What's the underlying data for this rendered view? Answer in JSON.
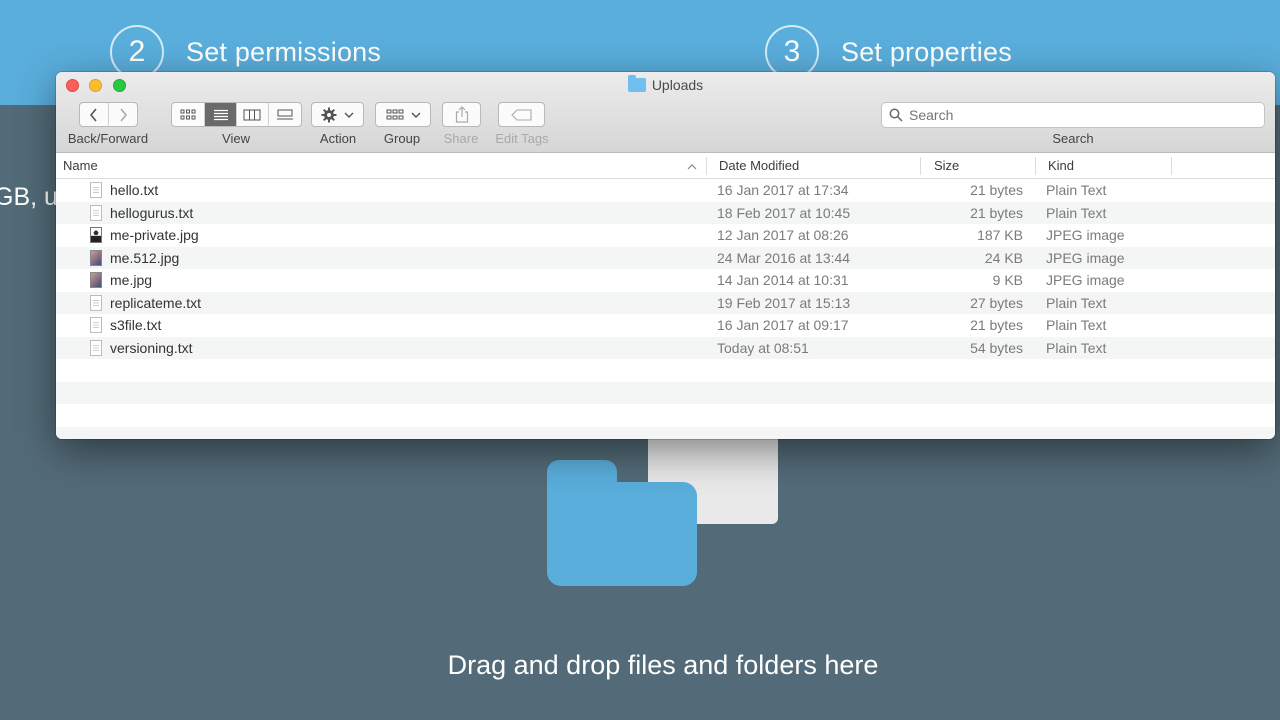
{
  "background": {
    "steps": [
      {
        "number": "2",
        "title": "Set permissions"
      },
      {
        "number": "3",
        "title": "Set properties"
      }
    ],
    "left_partial_text": "GB, u",
    "dropzone_text": "Drag and drop files and folders here"
  },
  "finder": {
    "title": "Uploads",
    "toolbar": {
      "back_forward_label": "Back/Forward",
      "view_label": "View",
      "action_label": "Action",
      "group_label": "Group",
      "share_label": "Share",
      "edit_tags_label": "Edit Tags",
      "search_label": "Search",
      "search_placeholder": "Search",
      "selected_view": "list"
    },
    "columns": {
      "name": "Name",
      "date": "Date Modified",
      "size": "Size",
      "kind": "Kind"
    },
    "files": [
      {
        "name": "hello.txt",
        "date": "16 Jan 2017 at 17:34",
        "size": "21 bytes",
        "kind": "Plain Text",
        "icon": "text-file-icon"
      },
      {
        "name": "hellogurus.txt",
        "date": "18 Feb 2017 at 10:45",
        "size": "21 bytes",
        "kind": "Plain Text",
        "icon": "text-file-icon"
      },
      {
        "name": "me-private.jpg",
        "date": "12 Jan 2017 at 08:26",
        "size": "187 KB",
        "kind": "JPEG image",
        "icon": "portrait-image-icon"
      },
      {
        "name": "me.512.jpg",
        "date": "24 Mar 2016 at 13:44",
        "size": "24 KB",
        "kind": "JPEG image",
        "icon": "image-file-icon"
      },
      {
        "name": "me.jpg",
        "date": "14 Jan 2014 at 10:31",
        "size": "9 KB",
        "kind": "JPEG image",
        "icon": "image-file-icon"
      },
      {
        "name": "replicateme.txt",
        "date": "19 Feb 2017 at 15:13",
        "size": "27 bytes",
        "kind": "Plain Text",
        "icon": "text-file-icon"
      },
      {
        "name": "s3file.txt",
        "date": "16 Jan 2017 at 09:17",
        "size": "21 bytes",
        "kind": "Plain Text",
        "icon": "text-file-icon"
      },
      {
        "name": "versioning.txt",
        "date": "Today at 08:51",
        "size": "54 bytes",
        "kind": "Plain Text",
        "icon": "text-file-icon"
      }
    ]
  },
  "colors": {
    "accent_blue": "#5aaedc",
    "background_slate": "#536b78",
    "close": "#fc5f57",
    "minimize": "#fdbc2e",
    "maximize": "#28c840"
  }
}
